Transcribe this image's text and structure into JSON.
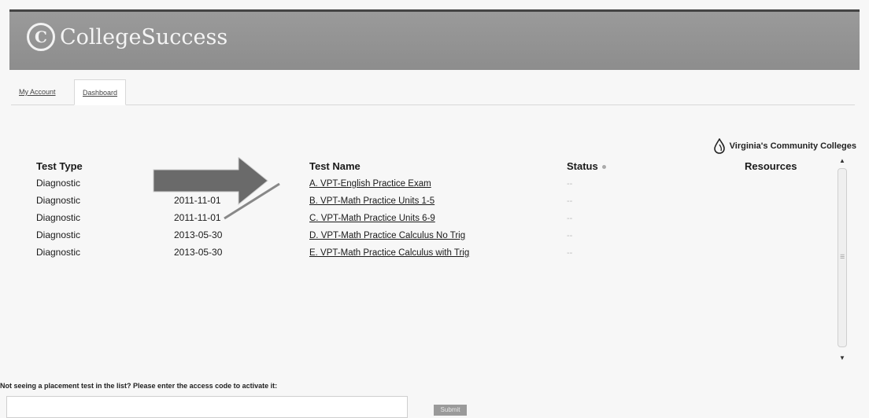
{
  "brand": {
    "name": "CollegeSuccess",
    "icon": "college-success-logo"
  },
  "tabs": [
    {
      "label": "My Account"
    },
    {
      "label": "Dashboard"
    }
  ],
  "partner": {
    "name": "Virginia's Community Colleges",
    "icon": "flame-logo"
  },
  "table": {
    "headers": {
      "type": "Test Type",
      "name": "Test Name",
      "status": "Status",
      "resources": "Resources"
    },
    "rows": [
      {
        "type": "Diagnostic",
        "date": "",
        "name": "A. VPT-English Practice Exam",
        "status": "--"
      },
      {
        "type": "Diagnostic",
        "date": "2011-11-01",
        "name": "B. VPT-Math Practice Units 1-5",
        "status": "--"
      },
      {
        "type": "Diagnostic",
        "date": "2011-11-01",
        "name": "C. VPT-Math Practice Units 6-9",
        "status": "--"
      },
      {
        "type": "Diagnostic",
        "date": "2013-05-30",
        "name": "D. VPT-Math Practice Calculus No Trig",
        "status": "--"
      },
      {
        "type": "Diagnostic",
        "date": "2013-05-30",
        "name": "E. VPT-Math Practice Calculus with Trig",
        "status": "--"
      }
    ]
  },
  "access_code": {
    "prompt": "Not seeing a placement test in the list? Please enter the access code to activate it:",
    "placeholder": "",
    "submit_label": "Submit"
  },
  "colors": {
    "header_bg": "#8f8f8f",
    "arrow": "#6f6f6f"
  }
}
